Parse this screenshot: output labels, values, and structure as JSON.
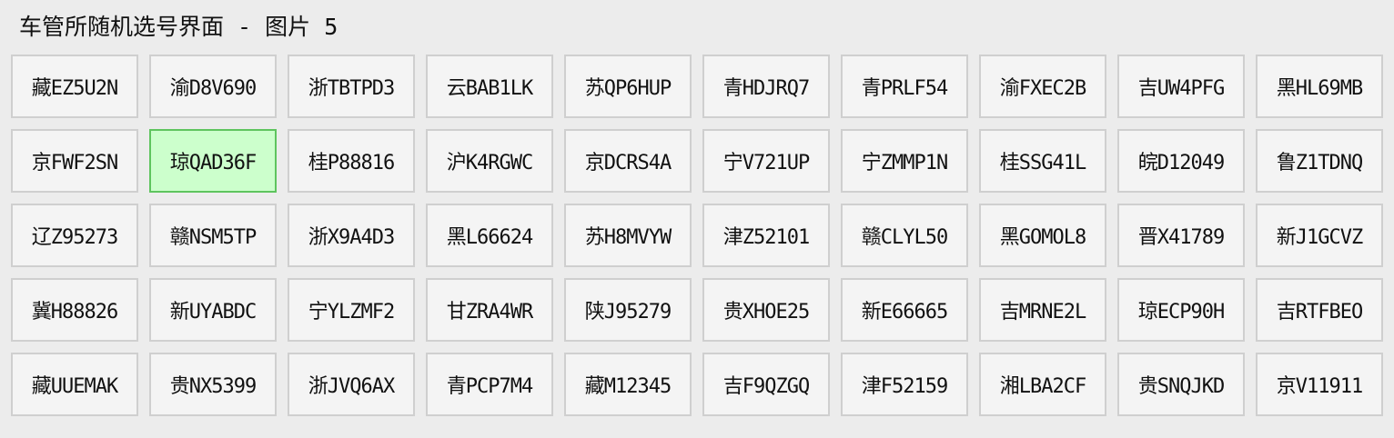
{
  "window": {
    "title": "车管所随机选号界面 - 图片 5"
  },
  "colors": {
    "background": "#ececec",
    "plate_background": "#f4f4f4",
    "plate_border": "#cfcfcf",
    "selected_background": "#ccffcc",
    "selected_border": "#5ec45e"
  },
  "selected_plate": "琼QAD36F",
  "plates": [
    [
      "藏EZ5U2N",
      "渝D8V690",
      "浙TBTPD3",
      "云BAB1LK",
      "苏QP6HUP",
      "青HDJRQ7",
      "青PRLF54",
      "渝FXEC2B",
      "吉UW4PFG",
      "黑HL69MB"
    ],
    [
      "京FWF2SN",
      "琼QAD36F",
      "桂P88816",
      "沪K4RGWC",
      "京DCRS4A",
      "宁V721UP",
      "宁ZMMP1N",
      "桂SSG41L",
      "皖D12049",
      "鲁Z1TDNQ"
    ],
    [
      "辽Z95273",
      "赣NSM5TP",
      "浙X9A4D3",
      "黑L66624",
      "苏H8MVYW",
      "津Z52101",
      "赣CLYL50",
      "黑GOMOL8",
      "晋X41789",
      "新J1GCVZ"
    ],
    [
      "冀H88826",
      "新UYABDC",
      "宁YLZMF2",
      "甘ZRA4WR",
      "陕J95279",
      "贵XHOE25",
      "新E66665",
      "吉MRNE2L",
      "琼ECP90H",
      "吉RTFBEO"
    ],
    [
      "藏UUEMAK",
      "贵NX5399",
      "浙JVQ6AX",
      "青PCP7M4",
      "藏M12345",
      "吉F9QZGQ",
      "津F52159",
      "湘LBA2CF",
      "贵SNQJKD",
      "京V11911"
    ]
  ]
}
